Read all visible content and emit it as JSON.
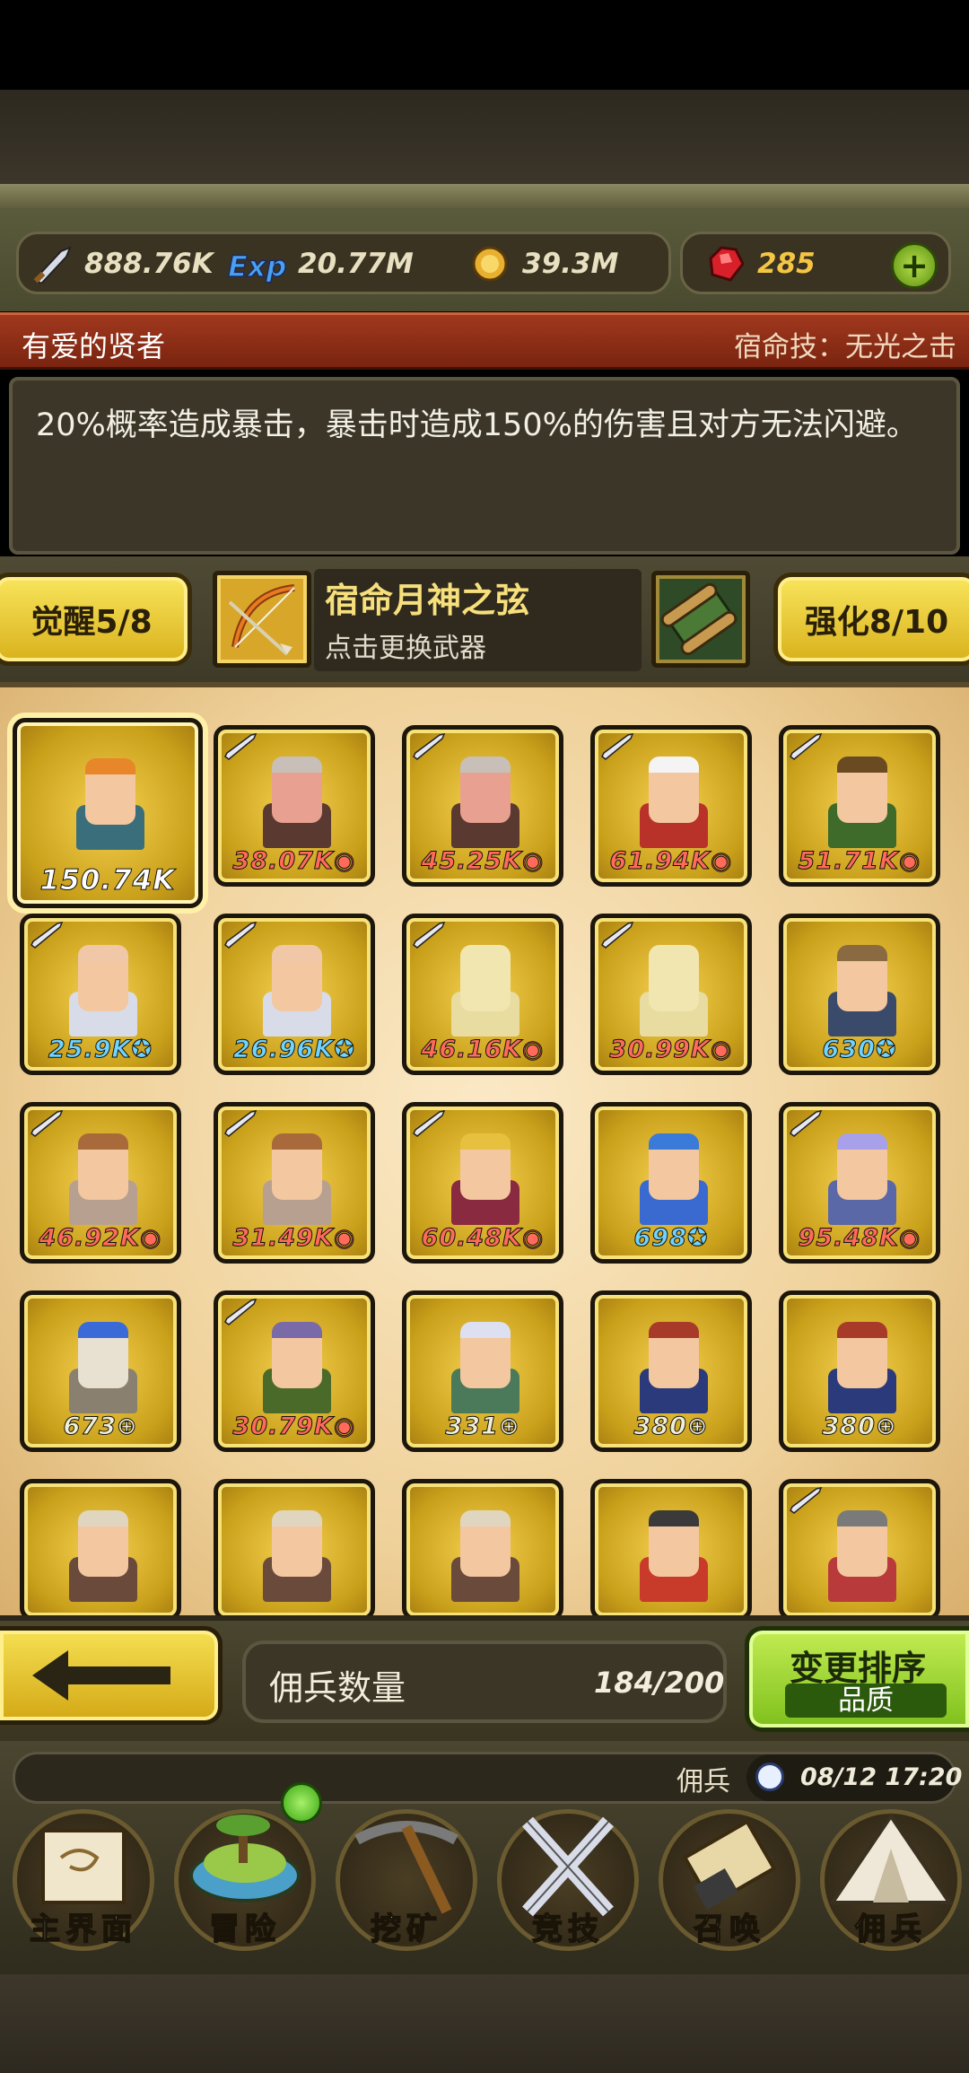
{
  "resources": {
    "attack": "888.76K",
    "exp": "20.77M",
    "gold": "39.3M",
    "gems": "285",
    "add_label": "+"
  },
  "hero": {
    "name": "有爱的贤者",
    "skill": "宿命技：无光之击",
    "description": "20%概率造成暴击，暴击时造成150%的伤害且对方无法闪避。"
  },
  "weapon": {
    "awaken_label": "觉醒5/8",
    "name": "宿命月神之弦",
    "hint": "点击更换武器",
    "enhance_label": "强化8/10"
  },
  "mercenaries": [
    {
      "value": "150.74K",
      "badge": "white",
      "sword": false,
      "hair": "#e8862a",
      "skin": "#f3c7a0",
      "cloth": "#3a6e7a",
      "selected": true
    },
    {
      "value": "38.07K",
      "badge": "red",
      "sword": true,
      "hair": "#c8c0b8",
      "skin": "#e8a090",
      "cloth": "#5a3a30"
    },
    {
      "value": "45.25K",
      "badge": "red",
      "sword": true,
      "hair": "#c8c0b8",
      "skin": "#e8a090",
      "cloth": "#5a3a30"
    },
    {
      "value": "61.94K",
      "badge": "red",
      "sword": true,
      "hair": "#f4f4f4",
      "skin": "#f3c7a0",
      "cloth": "#b8322a"
    },
    {
      "value": "51.71K",
      "badge": "red",
      "sword": true,
      "hair": "#6a4a20",
      "skin": "#f3c7a0",
      "cloth": "#3e6a2a"
    },
    {
      "value": "25.9K",
      "badge": "blue",
      "sword": true,
      "hair": "#f0c8a8",
      "skin": "#f3c7a0",
      "cloth": "#d8dce8"
    },
    {
      "value": "26.96K",
      "badge": "blue",
      "sword": true,
      "hair": "#f0c8a8",
      "skin": "#f3c7a0",
      "cloth": "#d8dce8"
    },
    {
      "value": "46.16K",
      "badge": "red",
      "sword": true,
      "hair": "#f2e6b0",
      "skin": "#f2e6b0",
      "cloth": "#e8dca0"
    },
    {
      "value": "30.99K",
      "badge": "red",
      "sword": true,
      "hair": "#f2e6b0",
      "skin": "#f2e6b0",
      "cloth": "#e8dca0"
    },
    {
      "value": "630",
      "badge": "blue",
      "sword": false,
      "hair": "#8a6a40",
      "skin": "#f3c7a0",
      "cloth": "#3a4a6a"
    },
    {
      "value": "46.92K",
      "badge": "red",
      "sword": true,
      "hair": "#a86a3a",
      "skin": "#f3c7a0",
      "cloth": "#b8a090"
    },
    {
      "value": "31.49K",
      "badge": "red",
      "sword": true,
      "hair": "#a86a3a",
      "skin": "#f3c7a0",
      "cloth": "#b8a090"
    },
    {
      "value": "60.48K",
      "badge": "red",
      "sword": true,
      "hair": "#e8c040",
      "skin": "#f3c7a0",
      "cloth": "#8a2a40"
    },
    {
      "value": "698",
      "badge": "blue",
      "sword": false,
      "hair": "#3a7ad8",
      "skin": "#f3c7a0",
      "cloth": "#3a6ad0"
    },
    {
      "value": "95.48K",
      "badge": "red",
      "sword": true,
      "hair": "#a8a0e8",
      "skin": "#f3c7a0",
      "cloth": "#5a68a8"
    },
    {
      "value": "673",
      "badge": "green",
      "sword": false,
      "hair": "#3a6ad8",
      "skin": "#e8e0d0",
      "cloth": "#8a8070"
    },
    {
      "value": "30.79K",
      "badge": "red",
      "sword": true,
      "hair": "#7a6aa8",
      "skin": "#f3c7a0",
      "cloth": "#4a6a2a"
    },
    {
      "value": "331",
      "badge": "green",
      "sword": false,
      "hair": "#dce0f0",
      "skin": "#f3c7a0",
      "cloth": "#4a7a5a"
    },
    {
      "value": "380",
      "badge": "green",
      "sword": false,
      "hair": "#a83a2a",
      "skin": "#f3c7a0",
      "cloth": "#2a3a7a"
    },
    {
      "value": "380",
      "badge": "green",
      "sword": false,
      "hair": "#a83a2a",
      "skin": "#f3c7a0",
      "cloth": "#2a3a7a"
    },
    {
      "value": "",
      "badge": "green",
      "sword": false,
      "hair": "#e0d6c0",
      "skin": "#f3c7a0",
      "cloth": "#6a4a3a"
    },
    {
      "value": "",
      "badge": "green",
      "sword": false,
      "hair": "#e0d6c0",
      "skin": "#f3c7a0",
      "cloth": "#6a4a3a"
    },
    {
      "value": "",
      "badge": "green",
      "sword": false,
      "hair": "#e0d6c0",
      "skin": "#f3c7a0",
      "cloth": "#6a4a3a"
    },
    {
      "value": "",
      "badge": "green",
      "sword": false,
      "hair": "#3a3a3a",
      "skin": "#f3c7a0",
      "cloth": "#c83a2a"
    },
    {
      "value": "",
      "badge": "blue",
      "sword": true,
      "hair": "#7a7a7a",
      "skin": "#f3c7a0",
      "cloth": "#b83a3a"
    }
  ],
  "roster": {
    "count_label": "佣兵数量",
    "count_value": "184/200",
    "sort_label": "变更排序",
    "sort_mode": "品质"
  },
  "ticker": {
    "text": "佣兵",
    "time": "08/12 17:20"
  },
  "nav": [
    {
      "label": "主界面",
      "icon": "scroll-map-icon"
    },
    {
      "label": "冒险",
      "icon": "island-icon"
    },
    {
      "label": "挖矿",
      "icon": "pickaxe-icon"
    },
    {
      "label": "竞技",
      "icon": "crossed-swords-icon"
    },
    {
      "label": "召唤",
      "icon": "summon-scroll-icon"
    },
    {
      "label": "佣兵",
      "icon": "tent-icon"
    }
  ]
}
